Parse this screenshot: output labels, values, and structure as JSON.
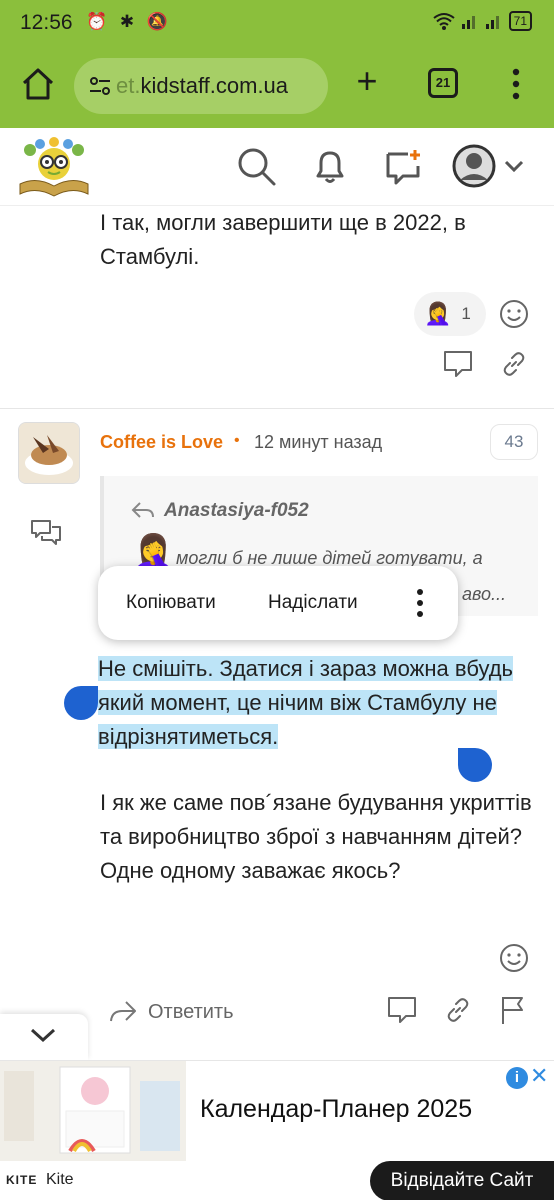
{
  "status_bar": {
    "time": "12:56",
    "battery": "71"
  },
  "browser": {
    "url_faded": "et.",
    "url_main": "kidstaff.com.ua",
    "tab_count": "21"
  },
  "prev_post": {
    "text": "І так, могли завершити ще в 2022, в Стамбулі.",
    "reaction_emoji": "🤦‍♀️",
    "reaction_count": "1"
  },
  "post": {
    "author": "Coffee is Love",
    "dot": "•",
    "time": "12 минут назад",
    "number": "43",
    "quote": {
      "author": "Anastasiya-f052",
      "emoji": "🤦‍♀️",
      "text_line1": "могли б не лише дітей готувати, а",
      "text_line2": "аво..."
    },
    "selected_text": "Не смішіть. Здатися і зараз можна вбудь який момент, це нічим віж Стамбулу не відрізнятиметься.",
    "text2": "І як же саме пов´язане будування укриттів та виробництво зброї з навчанням дітей? Одне одному заважає якось?",
    "reply_label": "Ответить"
  },
  "context_menu": {
    "copy": "Копіювати",
    "send": "Надіслати"
  },
  "ad": {
    "title": "Календар-Планер 2025",
    "info": "i",
    "close": "✕",
    "brand_logo": "KITE",
    "brand": "Kite",
    "cta": "Відвідайте Сайт"
  },
  "colors": {
    "browser_green": "#8bbf3c",
    "author_orange": "#e8720c",
    "selection_blue": "#bde4f7",
    "handle_blue": "#1e62d0"
  }
}
